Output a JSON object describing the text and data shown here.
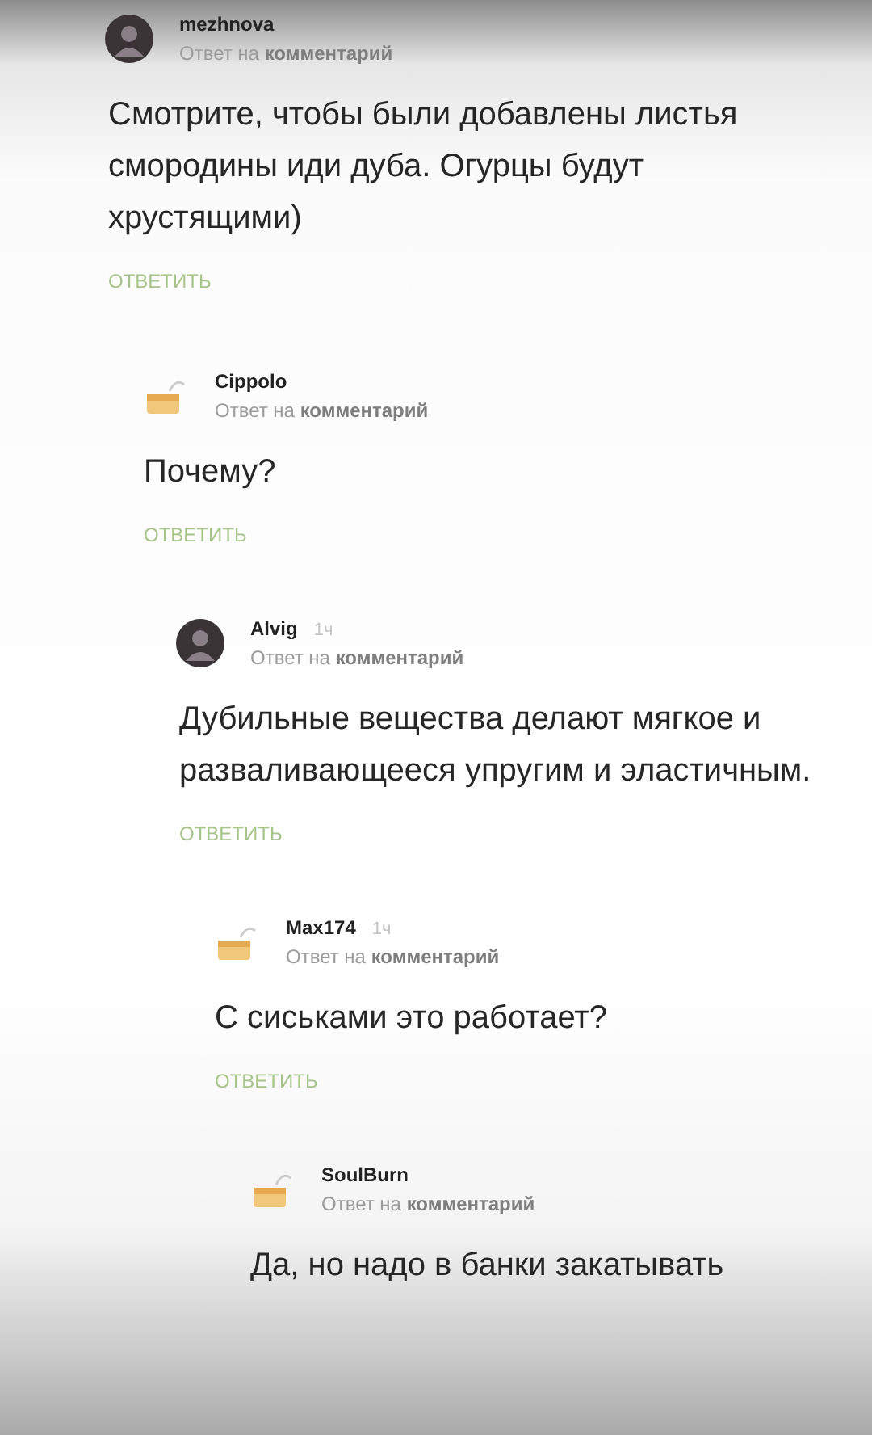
{
  "comments": [
    {
      "author": "mezhnova",
      "avatar": {
        "kind": "photo"
      },
      "meta": "Ответ на **комментарий**",
      "text": "Смотрите, чтобы были добавлены листья смородины иди дуба. Огурцы будут хрустящими)",
      "reply": "ОТВЕТИТЬ",
      "children": [
        {
          "author": "Cippolo",
          "avatar": {
            "kind": "default"
          },
          "meta": "Ответ на **комментарий**",
          "text": "Почему?",
          "reply": "ОТВЕТИТЬ",
          "children": [
            {
              "author": "Alvig",
              "time": "1ч",
              "avatar": {
                "kind": "photo"
              },
              "meta": "Ответ на **комментарий**",
              "text": "Дубильные вещества делают мягкое и разваливающееся упругим и эластичным.",
              "reply": "ОТВЕТИТЬ",
              "children": [
                {
                  "author": "Max174",
                  "time": "1ч",
                  "avatar": {
                    "kind": "default"
                  },
                  "meta": "Ответ на **комментарий**",
                  "text": "С сиськами это работает?",
                  "reply": "ОТВЕТИТЬ",
                  "children": [
                    {
                      "author": "SoulBurn",
                      "avatar": {
                        "kind": "default"
                      },
                      "meta": "Ответ на **комментарий**",
                      "text": "Да, но надо в банки закатывать"
                    }
                  ]
                }
              ]
            }
          ]
        }
      ]
    }
  ]
}
